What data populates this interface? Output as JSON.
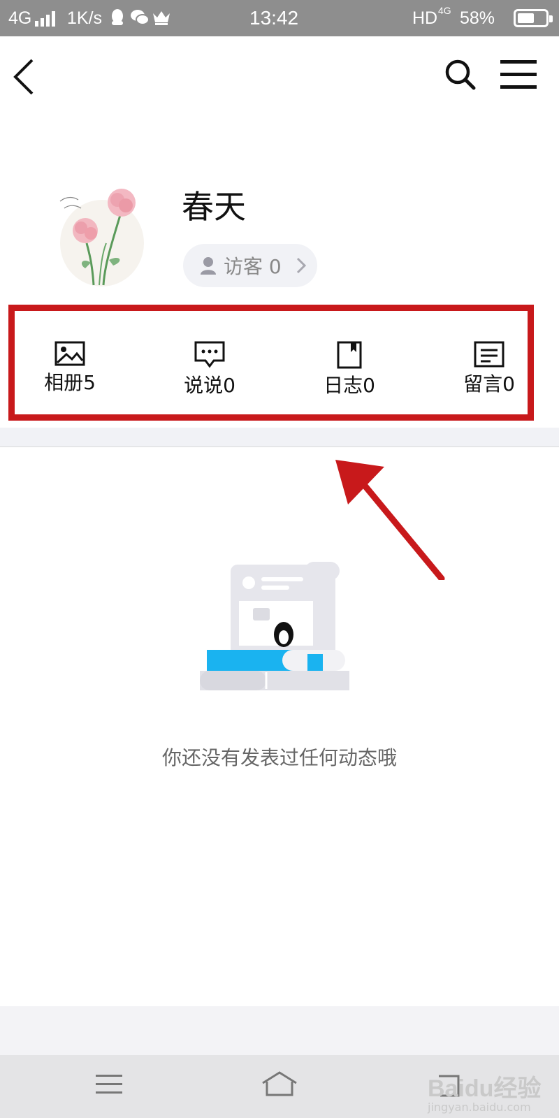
{
  "status_bar": {
    "network": "4G",
    "speed": "1K/s",
    "time": "13:42",
    "hd_label": "HD",
    "hd_network": "4G",
    "battery": "58%",
    "battery_level": 0.58,
    "icons": [
      "signal-icon",
      "qq-icon",
      "wechat-icon",
      "crown-icon",
      "battery-icon"
    ]
  },
  "nav": {
    "back_icon": "back-arrow-icon",
    "search_icon": "search-icon",
    "menu_icon": "menu-icon"
  },
  "profile": {
    "name": "春天",
    "visitor_label": "访客 0",
    "avatar_icon": "flower-avatar"
  },
  "shortcuts": [
    {
      "label": "相册5",
      "icon": "album-icon"
    },
    {
      "label": "说说0",
      "icon": "message-icon"
    },
    {
      "label": "日志0",
      "icon": "journal-icon"
    },
    {
      "label": "留言0",
      "icon": "comment-icon"
    }
  ],
  "empty": {
    "text": "你还没有发表过任何动态哦"
  },
  "system_nav": {
    "icons": [
      "recent-apps-icon",
      "home-icon",
      "back-icon"
    ]
  },
  "watermark": {
    "brand": "Baidu经验",
    "site": "jingyan.baidu.com"
  },
  "colors": {
    "highlight": "#c8191b",
    "status_bar_bg": "#8e8e8e",
    "pill_bg": "#f1f2f6",
    "accent_blue": "#1ab3f0"
  }
}
